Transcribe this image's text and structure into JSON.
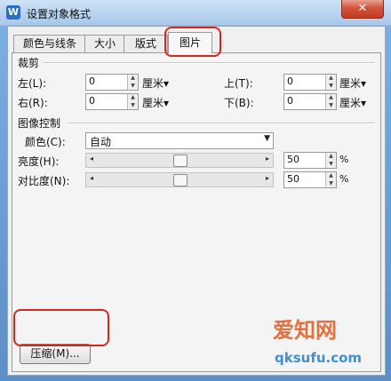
{
  "window": {
    "title": "设置对象格式",
    "close_glyph": "✕",
    "app_icon": "W"
  },
  "tabs": [
    {
      "label": "颜色与线条"
    },
    {
      "label": "大小"
    },
    {
      "label": "版式"
    },
    {
      "label": "图片",
      "active": true
    }
  ],
  "crop": {
    "section_title": "裁剪",
    "left": {
      "label": "左(L):",
      "value": "0",
      "unit": "厘米▾"
    },
    "top": {
      "label": "上(T):",
      "value": "0",
      "unit": "厘米▾"
    },
    "right": {
      "label": "右(R):",
      "value": "0",
      "unit": "厘米▾"
    },
    "bottom": {
      "label": "下(B):",
      "value": "0",
      "unit": "厘米▾"
    }
  },
  "image_control": {
    "section_title": "图像控制",
    "color": {
      "label": "颜色(C):",
      "value": "自动"
    },
    "brightness": {
      "label": "亮度(H):",
      "value": "50",
      "unit": "%",
      "level": 0.5
    },
    "contrast": {
      "label": "对比度(N):",
      "value": "50",
      "unit": "%",
      "level": 0.5
    }
  },
  "buttons": {
    "compress": "压缩(M)..."
  },
  "watermark": {
    "line1": "爱知网",
    "line2": "qksufu.com"
  }
}
